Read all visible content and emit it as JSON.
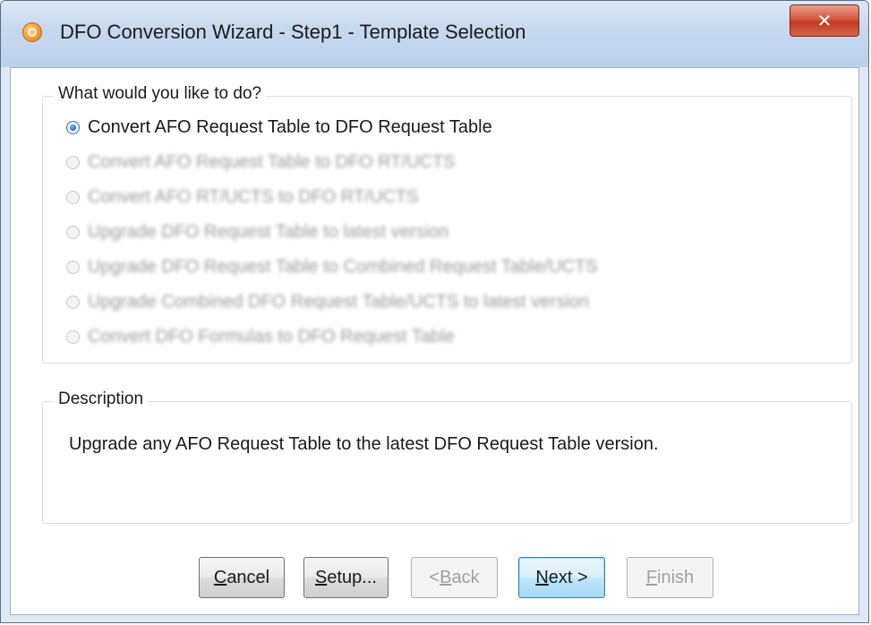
{
  "window": {
    "title": "DFO Conversion Wizard - Step1 - Template Selection",
    "icon": "app-logo-icon",
    "close_glyph": "✕"
  },
  "options_group": {
    "legend": "What would you like to do?",
    "options": [
      {
        "label": "Convert AFO Request Table to DFO Request Table",
        "checked": true,
        "enabled": true
      },
      {
        "label": "Convert AFO Request Table to DFO RT/UCTS",
        "checked": false,
        "enabled": false
      },
      {
        "label": "Convert AFO RT/UCTS to DFO RT/UCTS",
        "checked": false,
        "enabled": false
      },
      {
        "label": "Upgrade DFO Request Table to latest version",
        "checked": false,
        "enabled": false
      },
      {
        "label": "Upgrade DFO Request Table to Combined Request Table/UCTS",
        "checked": false,
        "enabled": false
      },
      {
        "label": "Upgrade Combined DFO Request Table/UCTS to latest version",
        "checked": false,
        "enabled": false
      },
      {
        "label": "Convert DFO Formulas to DFO Request Table",
        "checked": false,
        "enabled": false
      }
    ]
  },
  "description_group": {
    "legend": "Description",
    "text": "Upgrade any AFO Request Table to the latest DFO Request Table version."
  },
  "buttons": {
    "cancel": {
      "mnemonic": "C",
      "rest": "ancel",
      "enabled": true
    },
    "setup": {
      "mnemonic": "S",
      "rest": "etup...",
      "enabled": true
    },
    "back": {
      "prefix": "< ",
      "mnemonic": "B",
      "rest": "ack",
      "enabled": false
    },
    "next": {
      "mnemonic": "N",
      "rest": "ext >",
      "enabled": true
    },
    "finish": {
      "mnemonic": "F",
      "rest": "inish",
      "enabled": false
    }
  },
  "colors": {
    "title_bar": "#c6d8ee",
    "close_button": "#c13b22",
    "radio_accent": "#1d64b6",
    "default_button": "#3c7fb1"
  }
}
